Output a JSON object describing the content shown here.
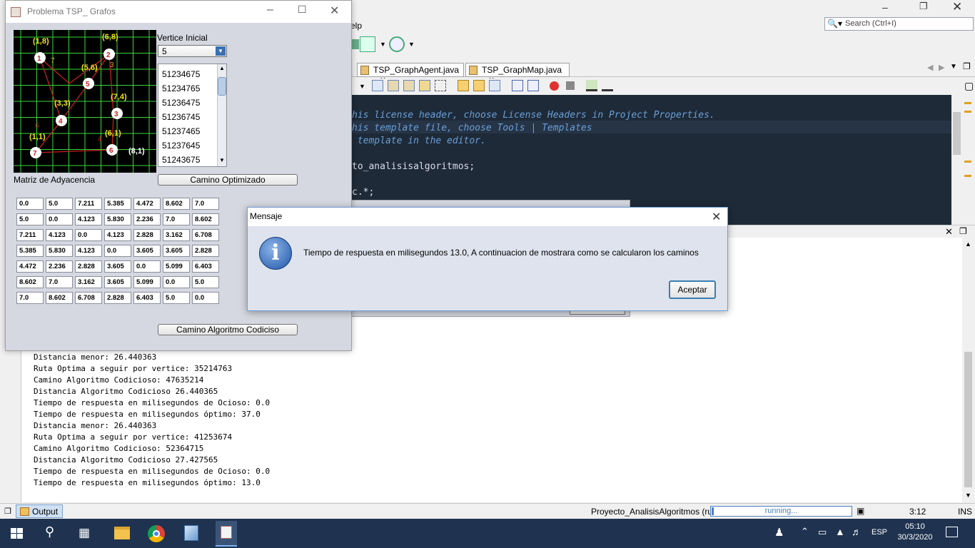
{
  "ide": {
    "menu_partial": "elp",
    "search_placeholder": "Search (Ctrl+I)",
    "tabs": [
      {
        "label": "TSP_GraphAgent.java"
      },
      {
        "label": "TSP_GraphMap.java"
      }
    ],
    "code_lines": [
      {
        "text": "his license header, choose License Headers in Project Properties.",
        "kind": "cmt"
      },
      {
        "text": "his template file, choose Tools | Templates",
        "kind": "cmt"
      },
      {
        "text": " template in the editor.",
        "kind": "cmt"
      },
      {
        "text": "",
        "kind": "plain"
      },
      {
        "text": "to_analisisalgoritmos;",
        "kind": "plain"
      },
      {
        "text": "",
        "kind": "plain"
      },
      {
        "text": "c.*;",
        "kind": "plain"
      }
    ],
    "output_lines": [
      "Distancia menor: 26.440363",
      "Ruta Optima a seguir por vertice: 35214763",
      "Camino Algoritmo Codicioso: 47635214",
      "Distancia Algoritmo Codicioso 26.440365",
      "Tiempo de respuesta en milisegundos de Ocioso: 0.0",
      "Tiempo de respuesta en milisegundos óptimo: 37.0",
      "Distancia menor: 26.440363",
      "Ruta Optima a seguir por vertice: 41253674",
      "Camino Algoritmo Codicioso: 52364715",
      "Distancia Algoritmo Codicioso 27.427565",
      "Tiempo de respuesta en milisegundos de Ocioso: 0.0",
      "Tiempo de respuesta en milisegundos óptimo: 13.0"
    ],
    "output_tab_label": "Output",
    "status_project": "Proyecto_AnalisisAlgoritmos (run)",
    "status_running": "running...",
    "status_position": "3:12",
    "status_mode": "INS"
  },
  "tsp": {
    "title": "Problema TSP_ Grafos",
    "vertice_label": "Vertice Inicial",
    "vertice_selected": "5",
    "routes": [
      "51234675",
      "51234765",
      "51236475",
      "51236745",
      "51237465",
      "51237645",
      "51243675"
    ],
    "optimized_button": "Camino Optimizado",
    "matrix_label": "Matriz de Adyacencia",
    "greedy_button": "Camino Algoritmo Codiciso",
    "matrix": [
      [
        "0.0",
        "5.0",
        "7.211",
        "5.385",
        "4.472",
        "8.602",
        "7.0"
      ],
      [
        "5.0",
        "0.0",
        "4.123",
        "5.830",
        "2.236",
        "7.0",
        "8.602"
      ],
      [
        "7.211",
        "4.123",
        "0.0",
        "4.123",
        "2.828",
        "3.162",
        "6.708"
      ],
      [
        "5.385",
        "5.830",
        "4.123",
        "0.0",
        "3.605",
        "3.605",
        "2.828"
      ],
      [
        "4.472",
        "2.236",
        "2.828",
        "3.605",
        "0.0",
        "5.099",
        "6.403"
      ],
      [
        "8.602",
        "7.0",
        "3.162",
        "3.605",
        "5.099",
        "0.0",
        "5.0"
      ],
      [
        "7.0",
        "8.602",
        "6.708",
        "2.828",
        "6.403",
        "5.0",
        "0.0"
      ]
    ],
    "graph": {
      "nodes": [
        {
          "id": "1",
          "coord": "(1,8)"
        },
        {
          "id": "2",
          "coord": "(6,8)"
        },
        {
          "id": "5",
          "coord": "(5,6)"
        },
        {
          "id": "4",
          "coord": "(3,3)"
        },
        {
          "id": "3",
          "coord": "(7,4)"
        },
        {
          "id": "6",
          "coord": "(6,1)"
        },
        {
          "id": "7",
          "coord": "(1,1)"
        }
      ],
      "extra_label": "(8,1)",
      "edge_labels": [
        "7",
        "3",
        "6",
        "4"
      ]
    }
  },
  "dialog": {
    "title": "Mensaje",
    "message": "Tiempo de respuesta en milisegundos 13.0, A continuacion de mostrara como se calcularon los caminos",
    "ok_button": "Aceptar"
  },
  "taskbar": {
    "lang": "ESP",
    "time": "05:10",
    "date": "30/3/2020"
  }
}
